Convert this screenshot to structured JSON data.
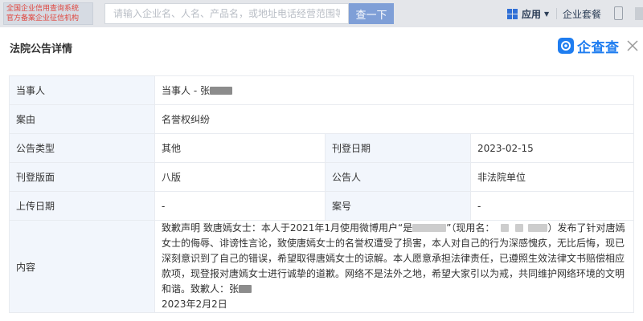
{
  "topbar": {
    "badge_line1": "全国企业信用查询系统",
    "badge_line2": "官方备案企业征信机构",
    "search_placeholder": "请输入企业名、人名、产品名，或地址电话经营范围等",
    "search_button": "查一下",
    "apps_label": "应用",
    "package_label": "企业套餐"
  },
  "modal": {
    "title": "法院公告详情",
    "logo_text": "企查查"
  },
  "details": {
    "party_label": "当事人",
    "party_value": "当事人 - 张",
    "cause_label": "案由",
    "cause_value": "名誉权纠纷",
    "type_label": "公告类型",
    "type_value": "其他",
    "pub_date_label": "刊登日期",
    "pub_date_value": "2023-02-15",
    "page_label": "刊登版面",
    "page_value": "八版",
    "announcer_label": "公告人",
    "announcer_value": "非法院单位",
    "upload_date_label": "上传日期",
    "upload_date_value": "-",
    "case_no_label": "案号",
    "case_no_value": "-",
    "content_label": "内容",
    "content_part1": "致歉声明 致唐嫣女士：本人于2021年1月使用微博用户“是",
    "content_part2": "”（现用名：",
    "content_part3": "）发布了针对唐嫣女士的侮辱、诽谤性言论，致使唐嫣女士的名誉权遭受了损害，本人对自己的行为深感愧疚，无比后悔，现已深刻意识到了自己的错误，希望取得唐嫣女士的谅解。本人愿意承担法律责任，已遵照生效法律文书赔偿相应款项，现登报对唐嫣女士进行诚挚的道歉。网络不是法外之地，希望大家引以为戒，共同维护网络环境的文明和谐。致歉人：张",
    "content_date": "2023年2月2日"
  },
  "colors": {
    "accent": "#1f7df0",
    "label_bg": "#f2f6fc",
    "search_button_bg": "#7f9fd7"
  }
}
